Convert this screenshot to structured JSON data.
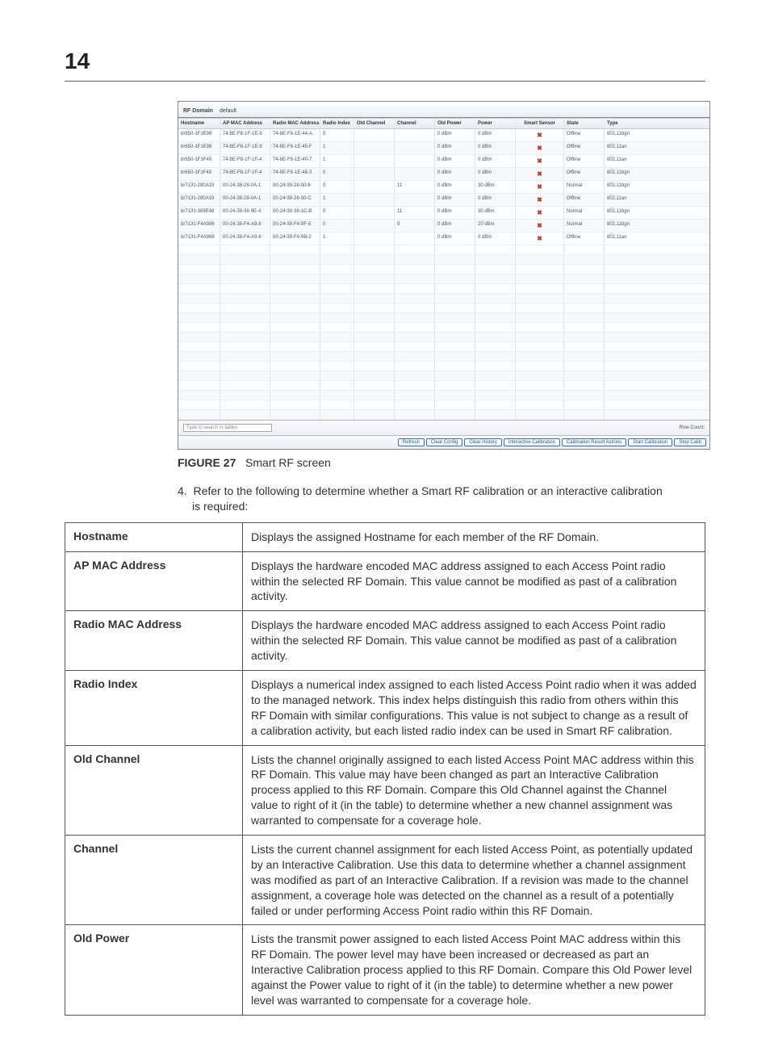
{
  "page_number": "14",
  "screenshot": {
    "rf_domain_label": "RF Domain",
    "rf_domain_value": "default",
    "columns": [
      "Hostname",
      "AP MAC Address",
      "Radio MAC Address",
      "Radio Index",
      "Old Channel",
      "Channel",
      "Old Power",
      "Power",
      "Smart Sensor",
      "State",
      "Type"
    ],
    "rows": [
      {
        "host": "br650-1F1E98",
        "ap": "74-8E-F8-1F-1E-9",
        "rmac": "74-8E-F8-1E-44-A",
        "ridx": "0",
        "oldch": "",
        "chan": "",
        "oldp": "0 dBm",
        "pwr": "0 dBm",
        "sens": "x",
        "state": "Offline",
        "type": "802.11bgn"
      },
      {
        "host": "br650-1F1E98",
        "ap": "74-8E-F8-1F-1E-9",
        "rmac": "74-8E-F8-1E-45-F",
        "ridx": "1",
        "oldch": "",
        "chan": "",
        "oldp": "0 dBm",
        "pwr": "0 dBm",
        "sens": "x",
        "state": "Offline",
        "type": "802.11an"
      },
      {
        "host": "br650-1F1F49",
        "ap": "74-8E-F8-1F-1F-4",
        "rmac": "74-8E-F8-1E-40-7",
        "ridx": "1",
        "oldch": "",
        "chan": "",
        "oldp": "0 dBm",
        "pwr": "0 dBm",
        "sens": "x",
        "state": "Offline",
        "type": "802.11an"
      },
      {
        "host": "br650-1F1F49",
        "ap": "74-8E-F8-1F-1F-4",
        "rmac": "74-8E-F8-1E-48-3",
        "ridx": "0",
        "oldch": "",
        "chan": "",
        "oldp": "0 dBm",
        "pwr": "0 dBm",
        "sens": "x",
        "state": "Offline",
        "type": "802.11bgn"
      },
      {
        "host": "br7131-280A19",
        "ap": "00-24-38-28-0A-1",
        "rmac": "00-24-38-28-00-8",
        "ridx": "0",
        "oldch": "",
        "chan": "11",
        "oldp": "0 dBm",
        "pwr": "30 dBm",
        "sens": "x",
        "state": "Normal",
        "type": "802.11bgn"
      },
      {
        "host": "br7131-280A19",
        "ap": "00-24-38-28-0A-1",
        "rmac": "00-24-38-28-00-C",
        "ridx": "1",
        "oldch": "",
        "chan": "",
        "oldp": "0 dBm",
        "pwr": "0 dBm",
        "sens": "x",
        "state": "Offline",
        "type": "802.11an"
      },
      {
        "host": "br7131-389E48",
        "ap": "00-24-38-38-9E-4",
        "rmac": "00-24-38-38-1C-B",
        "ridx": "0",
        "oldch": "",
        "chan": "11",
        "oldp": "0 dBm",
        "pwr": "30 dBm",
        "sens": "x",
        "state": "Normal",
        "type": "802.11bgn"
      },
      {
        "host": "br7131-F4A986",
        "ap": "00-24-38-F4-A9-8",
        "rmac": "00-24-38-F4-9F-8",
        "ridx": "0",
        "oldch": "",
        "chan": "9",
        "oldp": "0 dBm",
        "pwr": "20 dBm",
        "sens": "x",
        "state": "Normal",
        "type": "802.11bgn"
      },
      {
        "host": "br7131-F4A986",
        "ap": "00-24-38-F4-A9-8",
        "rmac": "00-24-38-F4-9B-2",
        "ridx": "1",
        "oldch": "",
        "chan": "",
        "oldp": "0 dBm",
        "pwr": "0 dBm",
        "sens": "x",
        "state": "Offline",
        "type": "802.11an"
      }
    ],
    "search_placeholder": "Type to search in tables",
    "row_count_label": "Row Count:",
    "buttons": [
      "Refresh",
      "Clear Config",
      "Clear History",
      "Interactive Calibration",
      "Calibration Result Actions",
      "Start Calibration",
      "Stop Calib"
    ]
  },
  "figure_label": "FIGURE 27",
  "figure_caption": "Smart RF screen",
  "step_number": "4.",
  "step_text": "Refer to the following to determine whether a Smart RF calibration or an interactive calibration is required:",
  "definitions": [
    {
      "term": "Hostname",
      "desc": "Displays the assigned Hostname for each member of the RF Domain."
    },
    {
      "term": "AP MAC Address",
      "desc": "Displays the hardware encoded MAC address assigned to each Access Point radio within the selected RF Domain. This value cannot be modified as past of a calibration activity."
    },
    {
      "term": "Radio MAC Address",
      "desc": "Displays the hardware encoded MAC address assigned to each Access Point radio within the selected RF Domain. This value cannot be modified as past of a calibration activity."
    },
    {
      "term": "Radio Index",
      "desc": "Displays a numerical index assigned to each listed Access Point radio when it was added to the managed network. This index helps distinguish this radio from others within this RF Domain with similar configurations. This value is not subject to change as a result of a calibration activity, but each listed radio index can be used in Smart RF calibration."
    },
    {
      "term": "Old Channel",
      "desc": "Lists the channel originally assigned to each listed Access Point MAC address within this RF Domain. This value may have been changed as part an Interactive Calibration process applied to this RF Domain. Compare this Old Channel against the Channel value to right of it (in the table) to determine whether a new channel assignment was warranted to compensate for a coverage hole."
    },
    {
      "term": "Channel",
      "desc": "Lists the current channel assignment for each listed Access Point, as potentially updated by an Interactive Calibration. Use this data to determine whether a channel assignment was modified as part of an Interactive Calibration. If a revision was made to the channel assignment, a coverage hole was detected on the channel as a result of a potentially failed or under performing Access Point radio within this RF Domain."
    },
    {
      "term": "Old Power",
      "desc": "Lists the transmit power assigned to each listed Access Point MAC address within this RF Domain. The power level may have been increased or decreased as part an Interactive Calibration process applied to this RF Domain. Compare this Old Power level against the Power value to right of it (in the table) to determine whether a new power level was warranted to compensate for a coverage hole."
    }
  ]
}
